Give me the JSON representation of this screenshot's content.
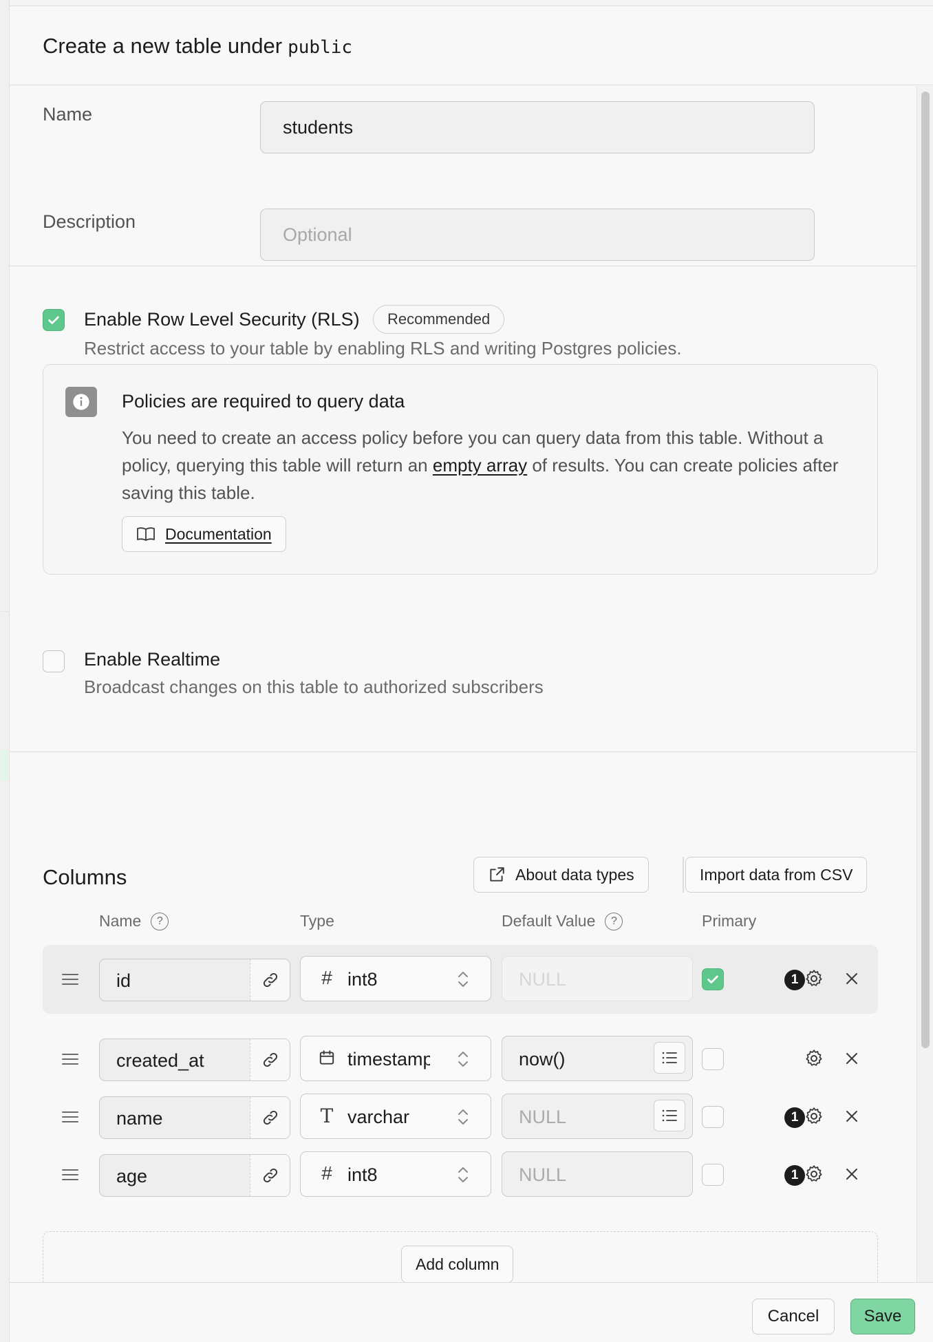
{
  "header": {
    "title": "Create a new table under",
    "schema": "public"
  },
  "form": {
    "name_label": "Name",
    "name_value": "students",
    "description_label": "Description",
    "description_placeholder": "Optional"
  },
  "rls": {
    "checked": true,
    "title": "Enable Row Level Security (RLS)",
    "badge": "Recommended",
    "description": "Restrict access to your table by enabling RLS and writing Postgres policies."
  },
  "callout": {
    "title": "Policies are required to query data",
    "body_before": "You need to create an access policy before you can query data from this table. Without a policy, querying this table will return an ",
    "body_link": "empty array",
    "body_after": " of results. You can create policies after saving this table.",
    "doc_button": "Documentation"
  },
  "realtime": {
    "checked": false,
    "title": "Enable Realtime",
    "description": "Broadcast changes on this table to authorized subscribers"
  },
  "columns": {
    "title": "Columns",
    "about_button": "About data types",
    "import_button": "Import data from CSV",
    "headers": {
      "name": "Name",
      "type": "Type",
      "default": "Default Value",
      "primary": "Primary"
    },
    "rows": [
      {
        "name": "id",
        "type": "int8",
        "type_icon": "hash-icon",
        "default": "NULL",
        "default_placeholder": true,
        "default_disabled": true,
        "has_menu": false,
        "primary": true,
        "badge": "1"
      },
      {
        "name": "created_at",
        "type": "timestamp",
        "type_icon": "calendar-icon",
        "default": "now()",
        "default_placeholder": false,
        "default_disabled": false,
        "has_menu": true,
        "primary": false,
        "badge": ""
      },
      {
        "name": "name",
        "type": "varchar",
        "type_icon": "text-type-icon",
        "default": "NULL",
        "default_placeholder": true,
        "default_disabled": false,
        "has_menu": true,
        "primary": false,
        "badge": "1"
      },
      {
        "name": "age",
        "type": "int8",
        "type_icon": "hash-icon",
        "default": "NULL",
        "default_placeholder": true,
        "default_disabled": false,
        "has_menu": false,
        "primary": false,
        "badge": "1"
      }
    ],
    "add_button": "Add column"
  },
  "footer": {
    "cancel": "Cancel",
    "save": "Save"
  },
  "colors": {
    "accent_green": "#5ec78b",
    "save_green": "#7fd6a2"
  }
}
